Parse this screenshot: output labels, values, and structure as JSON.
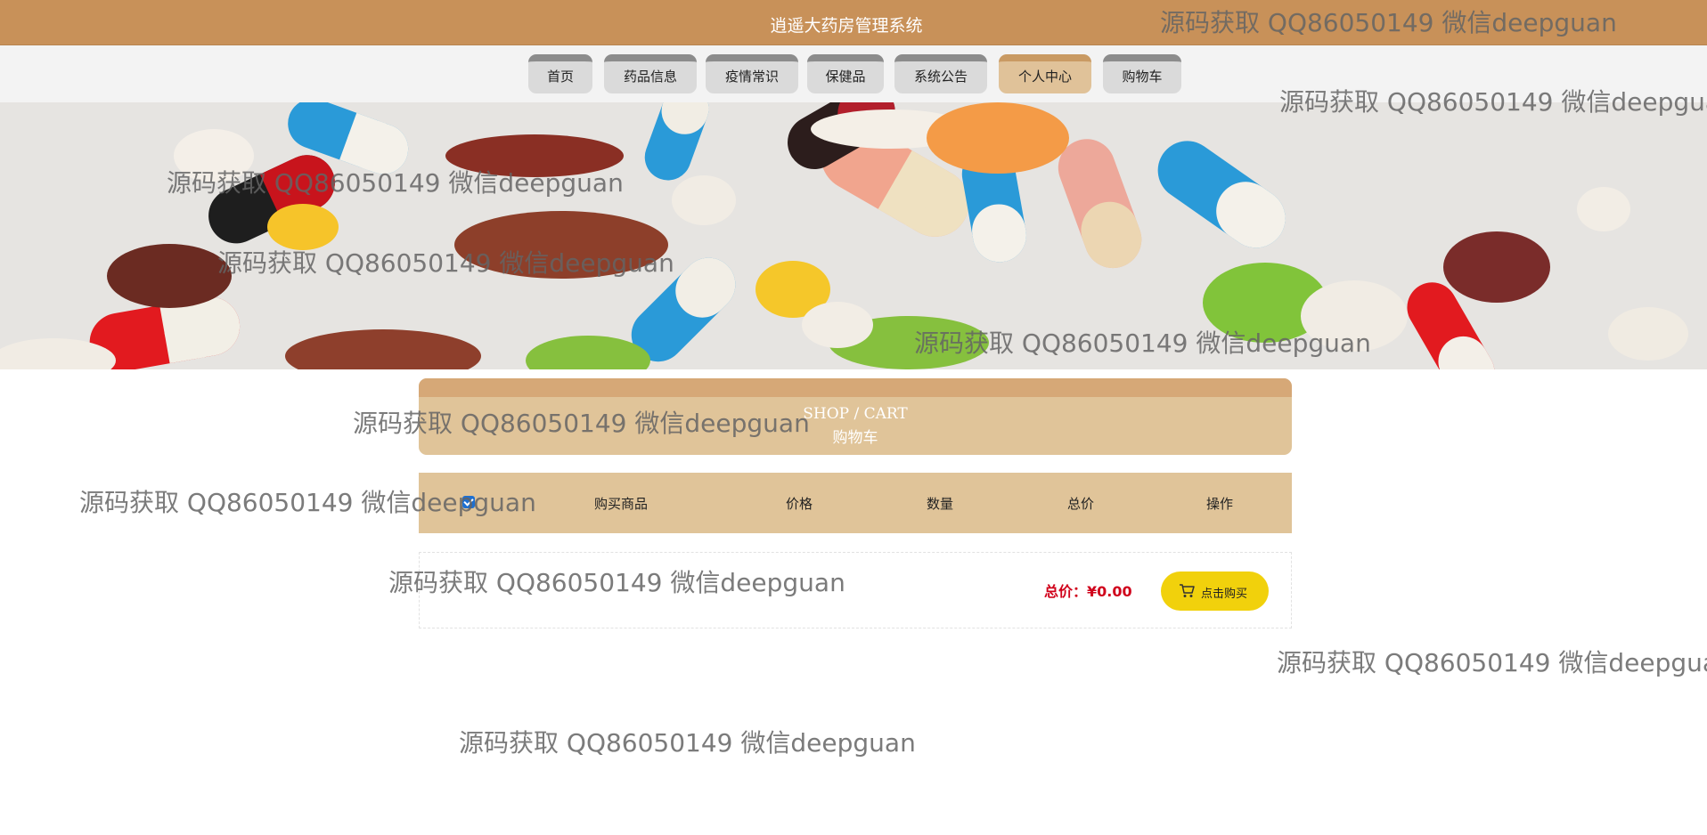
{
  "header": {
    "title": "逍遥大药房管理系统"
  },
  "nav": [
    {
      "label": "首页",
      "active": false
    },
    {
      "label": "药品信息",
      "active": false
    },
    {
      "label": "疫情常识",
      "active": false
    },
    {
      "label": "保健品",
      "active": false
    },
    {
      "label": "系统公告",
      "active": false
    },
    {
      "label": "个人中心",
      "active": true
    },
    {
      "label": "购物车",
      "active": false
    }
  ],
  "cart": {
    "title_en": "SHOP / CART",
    "title_cn": "购物车",
    "columns": [
      "购买商品",
      "价格",
      "数量",
      "总价",
      "操作"
    ],
    "select_all_checked": true,
    "total_label": "总价：¥0.00",
    "buy_button": "点击购买",
    "buy_icon": "cart-icon"
  },
  "watermark": "源码获取 QQ86050149 微信deepguan",
  "colors": {
    "header_bg": "#c89159",
    "nav_active": "#e0c299",
    "cart_panel": "#e0c499",
    "total_price": "#d0021b",
    "buy_button": "#f1d10c"
  }
}
